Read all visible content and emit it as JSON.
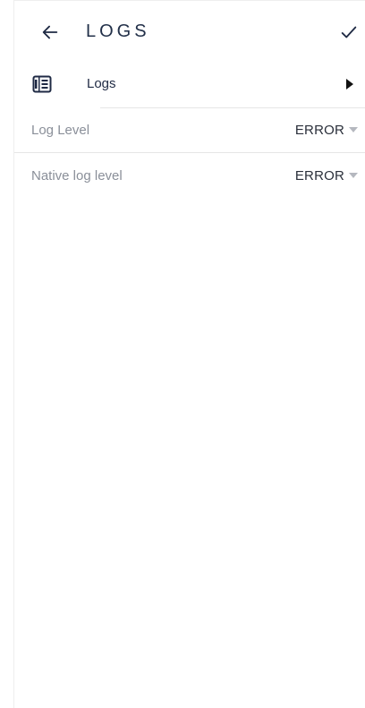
{
  "header": {
    "title": "LOGS",
    "back_icon": "arrow-left-icon",
    "confirm_icon": "check-icon"
  },
  "nav": {
    "label": "Logs",
    "icon": "newspaper-icon",
    "arrow_icon": "caret-right-icon"
  },
  "settings": [
    {
      "label": "Log Level",
      "value": "ERROR"
    },
    {
      "label": "Native log level",
      "value": "ERROR"
    }
  ],
  "colors": {
    "text_primary": "#1f2a44",
    "text_secondary": "#8a8f99",
    "divider": "#e6e6e6",
    "background": "#ffffff"
  }
}
